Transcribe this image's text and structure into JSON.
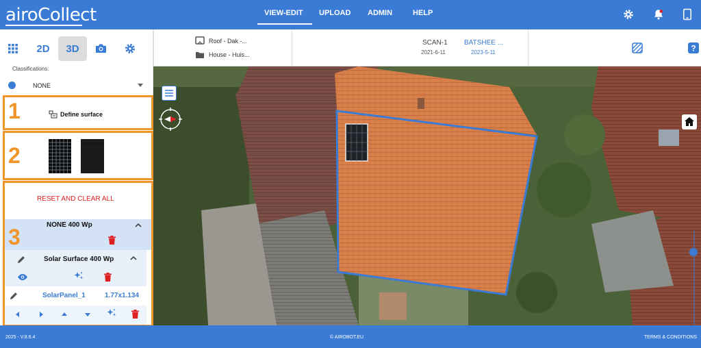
{
  "app": {
    "logo": "airoCollect"
  },
  "nav": {
    "items": [
      "VIEW-EDIT",
      "UPLOAD",
      "ADMIN",
      "HELP"
    ]
  },
  "toolbar": {
    "btn_2d": "2D",
    "btn_3d": "3D"
  },
  "classifications": {
    "label": "Classifications:",
    "value": "NONE"
  },
  "crumbs": {
    "roof": "Roof - Dak -...",
    "house": "House - Huis..."
  },
  "scans": {
    "scan1": {
      "name": "SCAN-1",
      "date": "2021-6-11"
    },
    "scan2": {
      "name": "BATSHEE ...",
      "date": "2023-5-11"
    }
  },
  "steps": {
    "one": "1",
    "two": "2",
    "three": "3"
  },
  "define_surface": "Define surface",
  "reset_label": "RESET AND CLEAR ALL",
  "group": {
    "title": "NONE 400 Wp"
  },
  "surface": {
    "title": "Solar Surface 400 Wp"
  },
  "panel": {
    "name": "SolarPanel_1",
    "size": "1.77x1.134"
  },
  "footer": {
    "version": "2025 - V.8.6.4",
    "copyright": "© AIROBOT.EU",
    "terms": "TERMS & CONDITIONS"
  },
  "colors": {
    "brand": "#3a7bd5",
    "accent": "#f0952a",
    "danger": "#e02020"
  }
}
